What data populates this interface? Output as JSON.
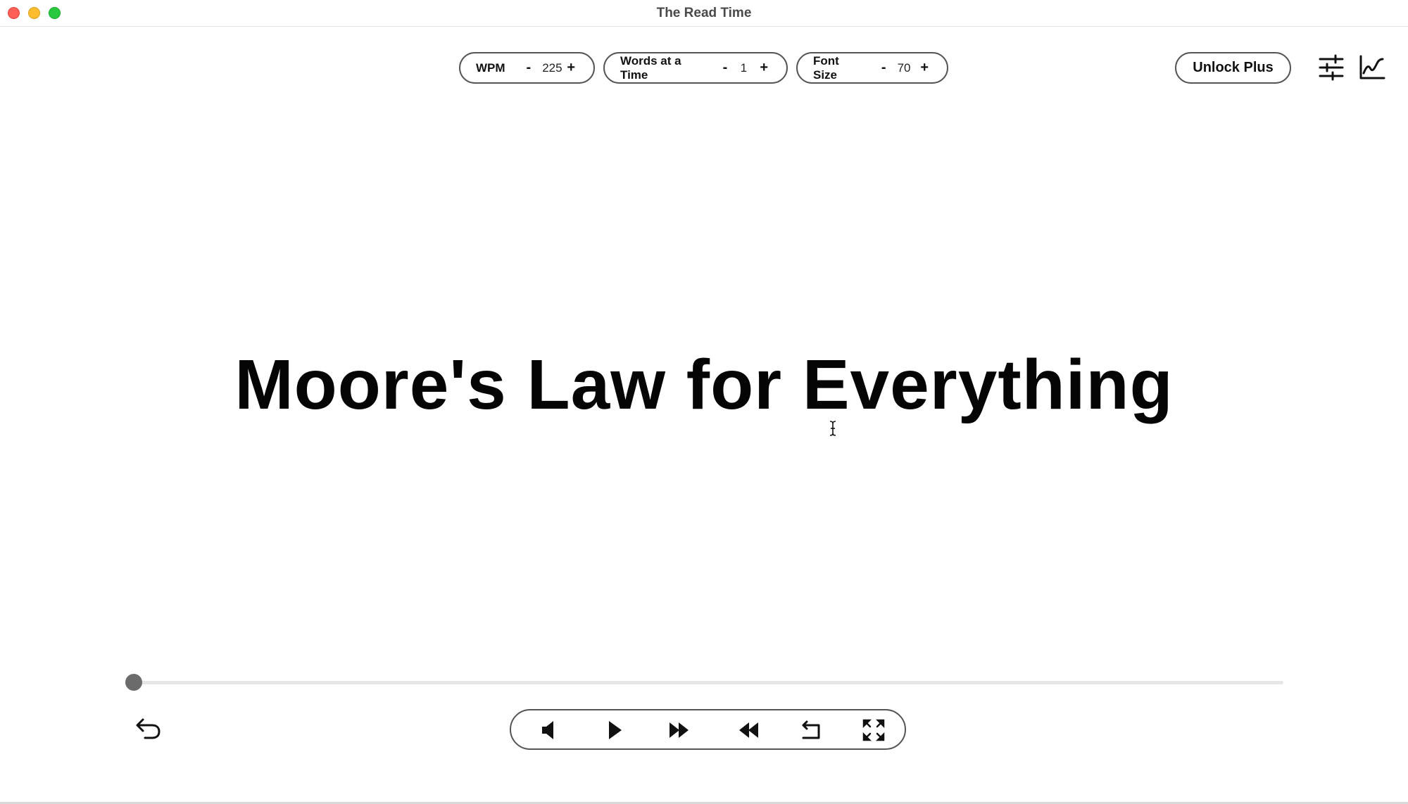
{
  "window": {
    "title": "The Read Time"
  },
  "toolbar": {
    "wpm": {
      "label": "WPM",
      "minus": "-",
      "value": "225",
      "plus": "+"
    },
    "words_at_a_time": {
      "label": "Words at a Time",
      "minus": "-",
      "value": "1",
      "plus": "+"
    },
    "font_size": {
      "label": "Font Size",
      "minus": "-",
      "value": "70",
      "plus": "+"
    },
    "unlock_label": "Unlock Plus",
    "settings_icon": "sliders-icon",
    "stats_icon": "line-chart-icon"
  },
  "reader": {
    "current_text": "Moore's Law for Everything"
  },
  "progress": {
    "fraction": 0.0
  },
  "playback": {
    "icons": [
      "undo-arrow-icon",
      "volume-icon",
      "play-icon",
      "fast-forward-icon",
      "rewind-icon",
      "return-arrow-icon",
      "fullscreen-icon"
    ]
  },
  "colors": {
    "close": "#fe5f57",
    "minimize": "#febc2e",
    "maximize": "#28c840",
    "border": "#555555",
    "thumb": "#6b6b6b"
  }
}
